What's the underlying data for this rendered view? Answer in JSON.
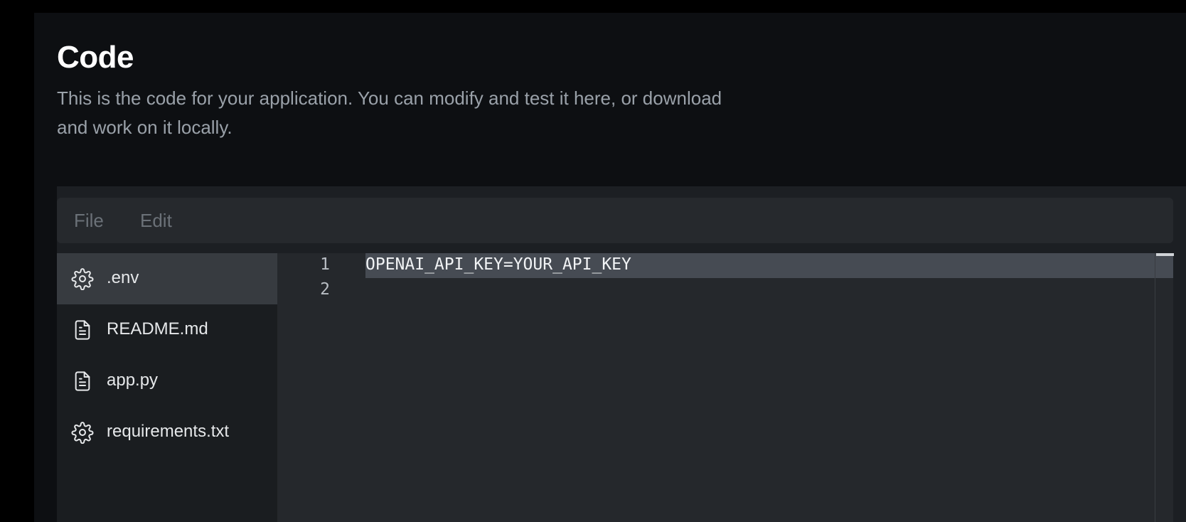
{
  "header": {
    "title": "Code",
    "description": "This is the code for your application. You can modify and test it here, or download and work on it locally."
  },
  "menubar": {
    "file_label": "File",
    "edit_label": "Edit"
  },
  "files": [
    {
      "name": ".env",
      "icon": "gear-icon",
      "active": true
    },
    {
      "name": "README.md",
      "icon": "file-text-icon",
      "active": false
    },
    {
      "name": "app.py",
      "icon": "file-text-icon",
      "active": false
    },
    {
      "name": "requirements.txt",
      "icon": "gear-icon",
      "active": false
    }
  ],
  "editor": {
    "lines": [
      {
        "number": "1",
        "content": "OPENAI_API_KEY=YOUR_API_KEY"
      },
      {
        "number": "2",
        "content": ""
      }
    ]
  },
  "colors": {
    "background": "#0d0f12",
    "active_file": "#373b40",
    "selection": "#464b53"
  }
}
